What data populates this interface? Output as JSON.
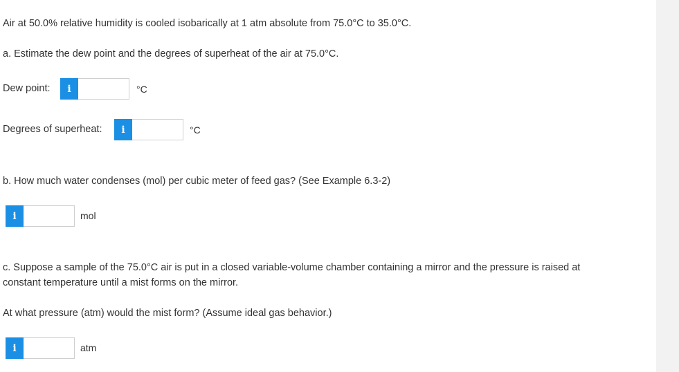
{
  "problem": {
    "intro": "Air at 50.0% relative humidity is cooled isobarically at 1 atm absolute from 75.0°C to 35.0°C.",
    "part_a": "a. Estimate the dew point and the degrees of superheat of the air at 75.0°C.",
    "part_b": "b. How much water condenses (mol) per cubic meter of feed gas? (See Example 6.3-2)",
    "part_c_line1": "c. Suppose a sample of the 75.0°C air is put in a closed variable-volume chamber containing a mirror and the pressure is raised at",
    "part_c_line2": "constant temperature until a mist forms on the mirror.",
    "part_c_question": "At what pressure (atm) would the mist form? (Assume ideal gas behavior.)"
  },
  "fields": {
    "dew_point": {
      "label": "Dew point:",
      "value": "",
      "unit": "°C"
    },
    "superheat": {
      "label": "Degrees of superheat:",
      "value": "",
      "unit": "°C"
    },
    "water_condensed": {
      "value": "",
      "unit": "mol"
    },
    "mist_pressure": {
      "value": "",
      "unit": "atm"
    }
  },
  "info_icon_glyph": "i",
  "colors": {
    "info_button": "#1a8fe3",
    "text": "#333333",
    "side_panel": "#f2f2f2"
  }
}
